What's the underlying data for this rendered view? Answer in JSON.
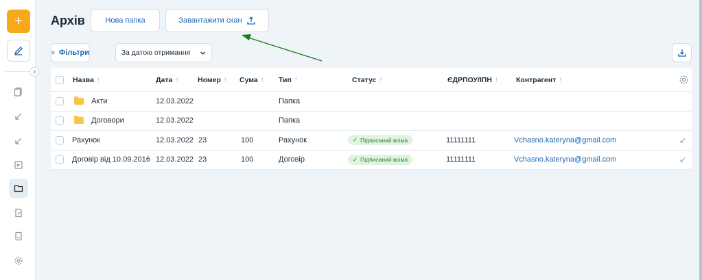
{
  "sidebar": {
    "add_label": "+",
    "icons": [
      "documents-icon",
      "incoming-arrow-icon",
      "incoming-arrow-icon",
      "outgoing-icon",
      "folder-icon",
      "document-edit-icon",
      "archive-icon",
      "gear-icon"
    ]
  },
  "header": {
    "title": "Архів",
    "new_folder_label": "Нова папка",
    "upload_scan_label": "Завантажити скан"
  },
  "toolbar": {
    "filters_label": "Фільтри",
    "sort_label": "За датою отримання"
  },
  "table": {
    "columns": {
      "name": "Назва",
      "date": "Дата",
      "number": "Номер",
      "sum": "Сума",
      "type": "Тип",
      "status": "Статус",
      "edrpou": "ЄДРПОУ/ІПН",
      "counterparty": "Контрагент"
    },
    "rows": [
      {
        "name": "Акти",
        "date": "12.03.2022",
        "number": "",
        "sum": "",
        "type": "Папка",
        "status": "",
        "edrpou": "",
        "counterparty": ""
      },
      {
        "name": "Договори",
        "date": "12.03.2022",
        "number": "",
        "sum": "",
        "type": "Папка",
        "status": "",
        "edrpou": "",
        "counterparty": ""
      },
      {
        "name": "Рахунок",
        "date": "12.03.2022",
        "number": "23",
        "sum": "100",
        "type": "Рахунок",
        "status": "Підписаний всіма",
        "edrpou": "11111111",
        "counterparty": "Vchasno.kateryna@gmail.com"
      },
      {
        "name": "Договір від 10.09.2016",
        "date": "12.03.2022",
        "number": "23",
        "sum": "100",
        "type": "Договір",
        "status": "Підписаний всіма",
        "edrpou": "11111111",
        "counterparty": "Vchasno.kateryna@gmail.com"
      }
    ]
  },
  "colors": {
    "accent": "#f7a81b",
    "link": "#1a64b8",
    "annotation_arrow": "#1a7a1a",
    "status_bg": "#dff3df"
  }
}
